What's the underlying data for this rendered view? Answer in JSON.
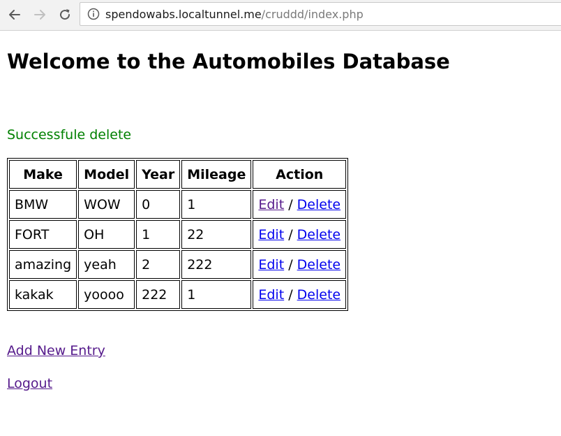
{
  "browser": {
    "url_host": "spendowabs.localtunnel.me",
    "url_path": "/cruddd/index.php",
    "back_icon": "arrow-left-icon",
    "forward_icon": "arrow-right-icon",
    "reload_icon": "reload-icon",
    "info_icon": "info-icon"
  },
  "page": {
    "title": "Welcome to the Automobiles Database",
    "flash_message": "Successfule delete",
    "flash_color": "#008000",
    "add_link": "Add New Entry",
    "logout_link": "Logout"
  },
  "table": {
    "headers": [
      "Make",
      "Model",
      "Year",
      "Mileage",
      "Action"
    ],
    "rows": [
      {
        "make": "BMW",
        "model": "WOW",
        "year": "0",
        "mileage": "1",
        "edit": "Edit",
        "sep": "/",
        "delete": "Delete"
      },
      {
        "make": "FORT",
        "model": "OH",
        "year": "1",
        "mileage": "22",
        "edit": "Edit",
        "sep": "/",
        "delete": "Delete"
      },
      {
        "make": "amazing",
        "model": "yeah",
        "year": "2",
        "mileage": "222",
        "edit": "Edit",
        "sep": "/",
        "delete": "Delete"
      },
      {
        "make": "kakak",
        "model": "yoooo",
        "year": "222",
        "mileage": "1",
        "edit": "Edit",
        "sep": "/",
        "delete": "Delete"
      }
    ]
  },
  "colors": {
    "link": "#0000ee",
    "visited_link": "#551a8b",
    "success": "#008000"
  }
}
